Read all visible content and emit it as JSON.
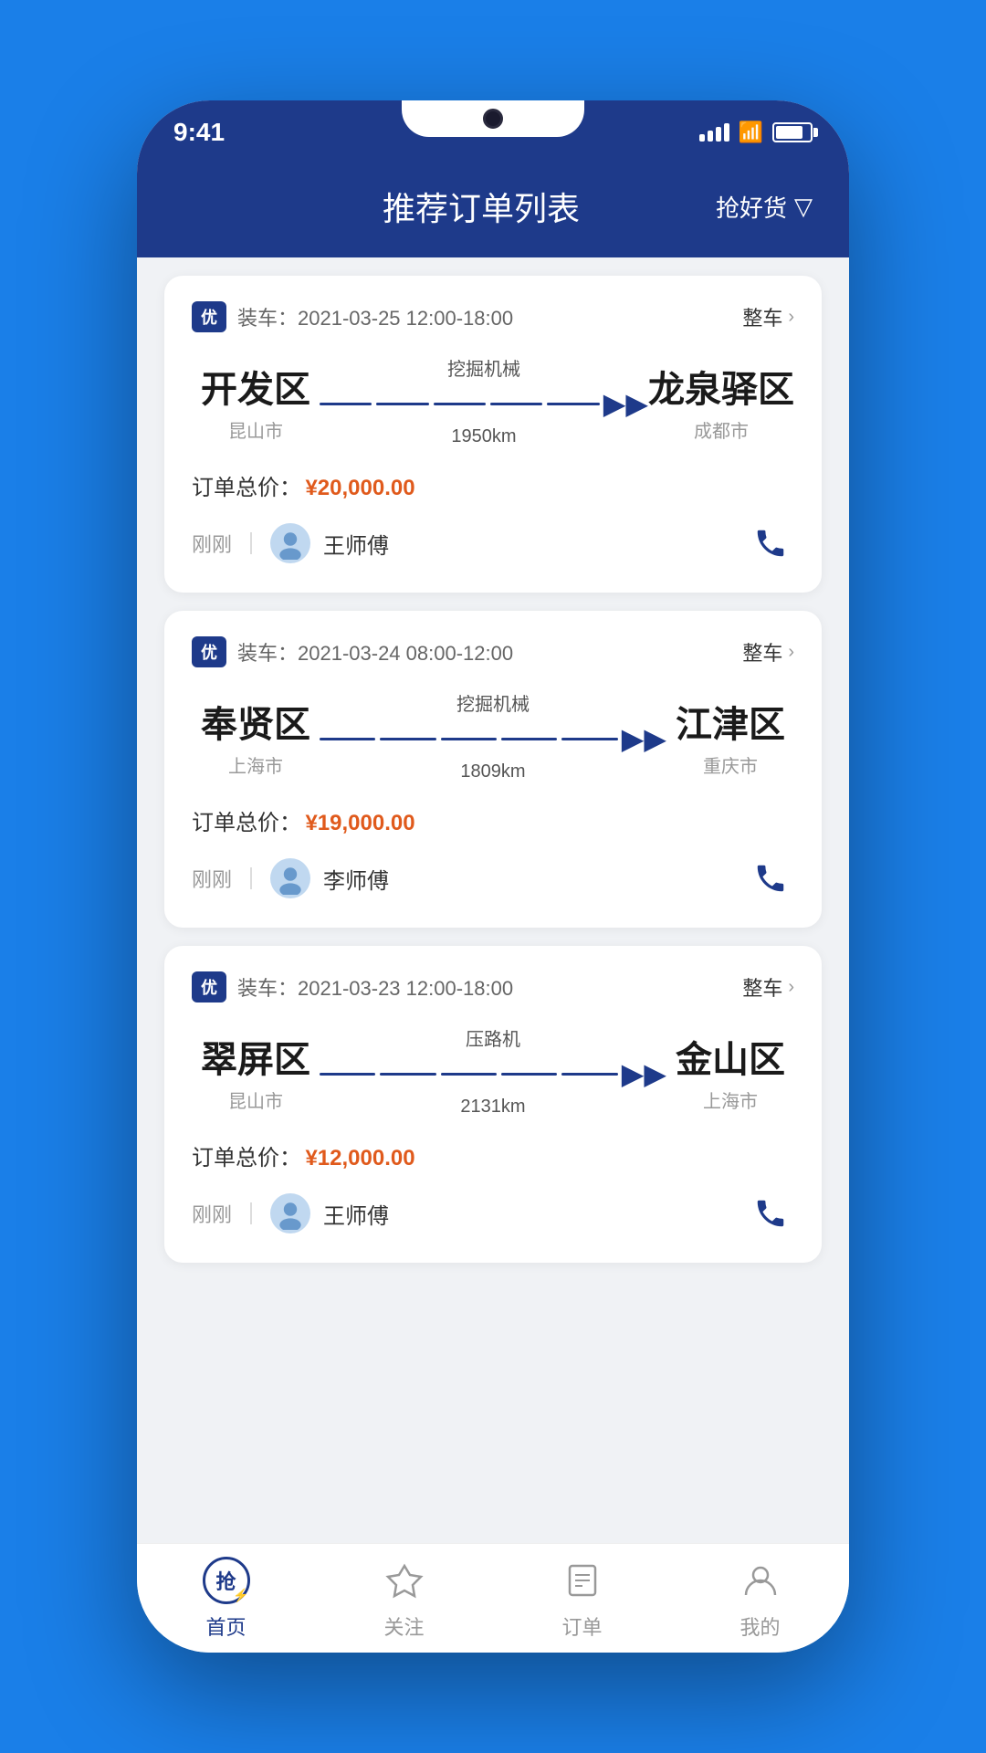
{
  "page": {
    "background_color": "#1a7fe8"
  },
  "status_bar": {
    "time": "9:41",
    "signal": "full",
    "wifi": true,
    "battery": 80
  },
  "header": {
    "title": "推荐订单列表",
    "action_label": "抢好货",
    "filter_icon": "filter-icon"
  },
  "orders": [
    {
      "id": "order-1",
      "badge": "优",
      "load_time": "装车：2021-03-25 12:00-18:00",
      "cargo_type": "整车",
      "from_city": "开发区",
      "from_sub": "昆山市",
      "to_city": "龙泉驿区",
      "to_sub": "成都市",
      "goods_type": "挖掘机械",
      "distance": "1950km",
      "total_price_label": "订单总价：",
      "total_price": "¥20,000.00",
      "time_ago": "刚刚",
      "driver_name": "王师傅"
    },
    {
      "id": "order-2",
      "badge": "优",
      "load_time": "装车：2021-03-24 08:00-12:00",
      "cargo_type": "整车",
      "from_city": "奉贤区",
      "from_sub": "上海市",
      "to_city": "江津区",
      "to_sub": "重庆市",
      "goods_type": "挖掘机械",
      "distance": "1809km",
      "total_price_label": "订单总价：",
      "total_price": "¥19,000.00",
      "time_ago": "刚刚",
      "driver_name": "李师傅"
    },
    {
      "id": "order-3",
      "badge": "优",
      "load_time": "装车：2021-03-23 12:00-18:00",
      "cargo_type": "整车",
      "from_city": "翠屏区",
      "from_sub": "昆山市",
      "to_city": "金山区",
      "to_sub": "上海市",
      "goods_type": "压路机",
      "distance": "2131km",
      "total_price_label": "订单总价：",
      "total_price": "¥12,000.00",
      "time_ago": "刚刚",
      "driver_name": "王师傅"
    }
  ],
  "bottom_nav": {
    "items": [
      {
        "id": "home",
        "label": "首页",
        "active": true
      },
      {
        "id": "follow",
        "label": "关注",
        "active": false
      },
      {
        "id": "orders",
        "label": "订单",
        "active": false
      },
      {
        "id": "mine",
        "label": "我的",
        "active": false
      }
    ]
  }
}
